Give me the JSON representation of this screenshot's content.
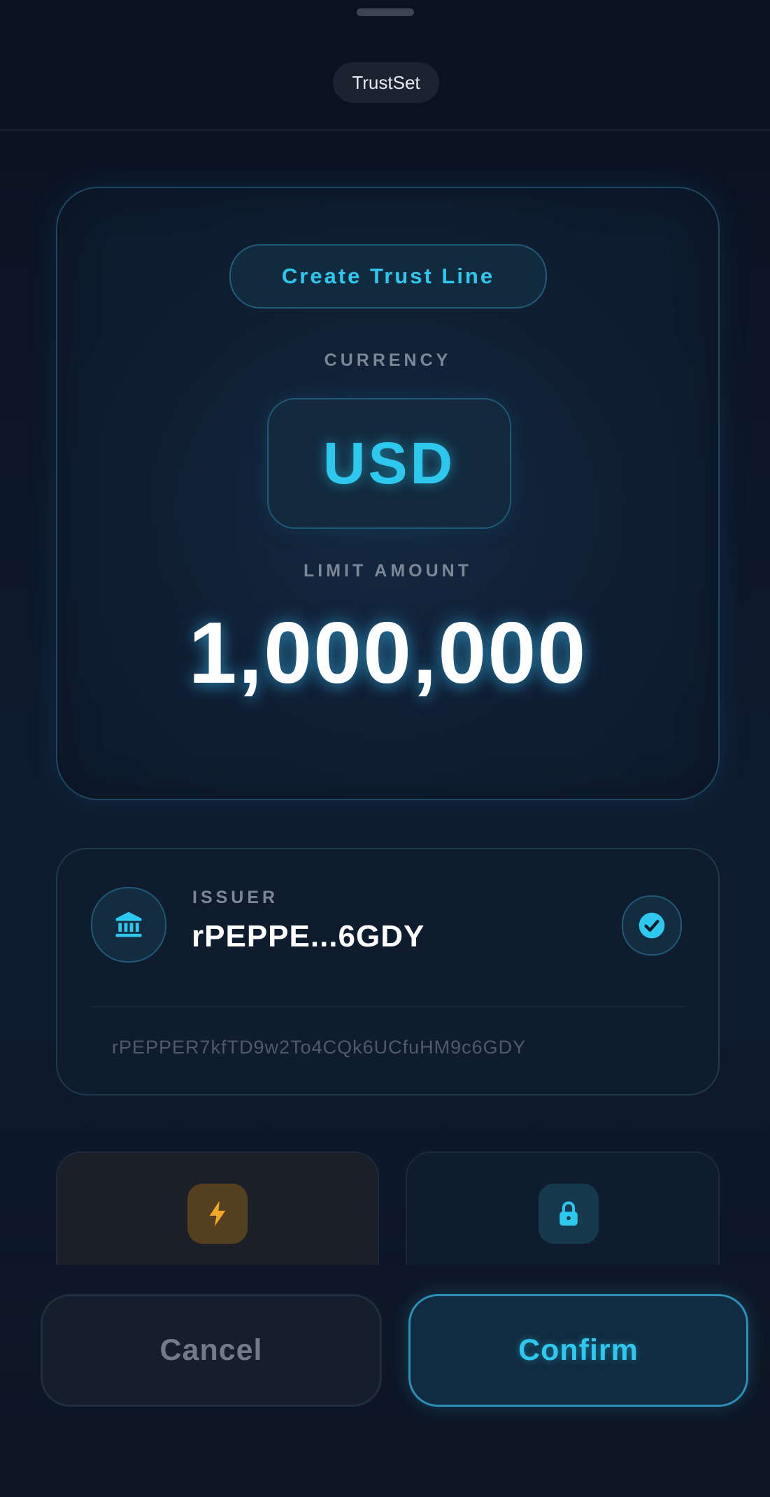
{
  "header": {
    "transaction_type": "TrustSet"
  },
  "main_card": {
    "action_label": "Create Trust Line",
    "currency_label": "CURRENCY",
    "currency_value": "USD",
    "limit_label": "LIMIT AMOUNT",
    "limit_value": "1,000,000"
  },
  "issuer": {
    "label": "ISSUER",
    "short_address": "rPEPPE...6GDY",
    "full_address": "rPEPPER7kfTD9w2To4CQk6UCfuHM9c6GDY",
    "icon": "bank-icon",
    "verified_icon": "check-circle-icon"
  },
  "flags": [
    {
      "icon": "lightning-icon",
      "color": "#f0a826"
    },
    {
      "icon": "lock-icon",
      "color": "#2ec8ee"
    }
  ],
  "actions": {
    "cancel_label": "Cancel",
    "confirm_label": "Confirm"
  },
  "colors": {
    "accent": "#2ec8ee",
    "background": "#0b1322",
    "warning": "#f0a826"
  }
}
